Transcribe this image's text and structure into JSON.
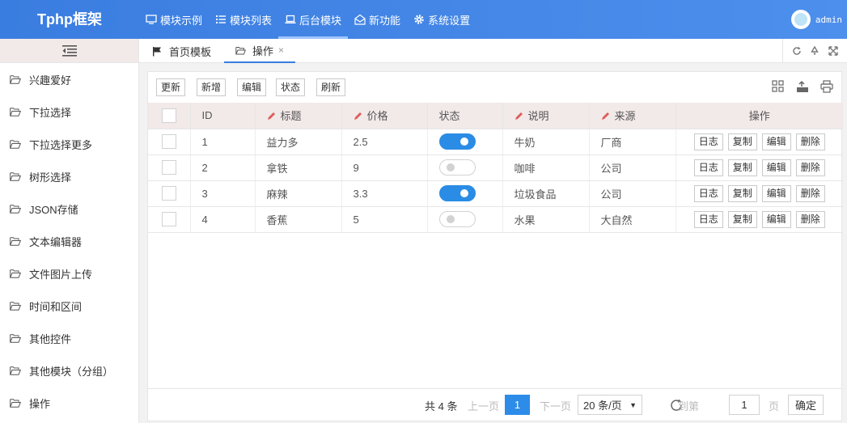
{
  "app": {
    "title": "Tphp框架"
  },
  "nav": [
    {
      "label": "模块示例",
      "icon": "monitor-icon"
    },
    {
      "label": "模块列表",
      "icon": "list-icon"
    },
    {
      "label": "后台模块",
      "icon": "laptop-icon",
      "active": true
    },
    {
      "label": "新功能",
      "icon": "envelope-open-icon"
    },
    {
      "label": "系统设置",
      "icon": "gear-icon"
    }
  ],
  "user": {
    "name": "admin"
  },
  "sidebar": {
    "items": [
      {
        "label": "兴趣爱好"
      },
      {
        "label": "下拉选择"
      },
      {
        "label": "下拉选择更多"
      },
      {
        "label": "树形选择"
      },
      {
        "label": "JSON存储"
      },
      {
        "label": "文本编辑器"
      },
      {
        "label": "文件图片上传"
      },
      {
        "label": "时间和区间"
      },
      {
        "label": "其他控件"
      },
      {
        "label": "其他模块（分组）"
      },
      {
        "label": "操作"
      }
    ]
  },
  "tabs": [
    {
      "label": "首页模板",
      "icon": "flag-icon"
    },
    {
      "label": "操作",
      "icon": "folder-open-icon",
      "active": true,
      "close": "×"
    }
  ],
  "toolbar": {
    "update": "更新",
    "add": "新增",
    "edit": "编辑",
    "status": "状态",
    "refresh": "刷新"
  },
  "table": {
    "headers": {
      "id": "ID",
      "title": "标题",
      "price": "价格",
      "status": "状态",
      "desc": "说明",
      "source": "来源",
      "actions": "操作"
    },
    "action_labels": {
      "log": "日志",
      "copy": "复制",
      "edit": "编辑",
      "delete": "删除"
    },
    "rows": [
      {
        "id": "1",
        "title": "益力多",
        "price": "2.5",
        "status_on": true,
        "desc": "牛奶",
        "source": "厂商"
      },
      {
        "id": "2",
        "title": "拿铁",
        "price": "9",
        "status_on": false,
        "desc": "咖啡",
        "source": "公司"
      },
      {
        "id": "3",
        "title": "麻辣",
        "price": "3.3",
        "status_on": true,
        "desc": "垃圾食品",
        "source": "公司"
      },
      {
        "id": "4",
        "title": "香蕉",
        "price": "5",
        "status_on": false,
        "desc": "水果",
        "source": "大自然"
      }
    ]
  },
  "pager": {
    "total": "共 4 条",
    "prev": "上一页",
    "current": "1",
    "next": "下一页",
    "page_size": "20 条/页",
    "goto_label": "到第",
    "goto_value": "1",
    "page_unit": "页",
    "confirm": "确定"
  }
}
